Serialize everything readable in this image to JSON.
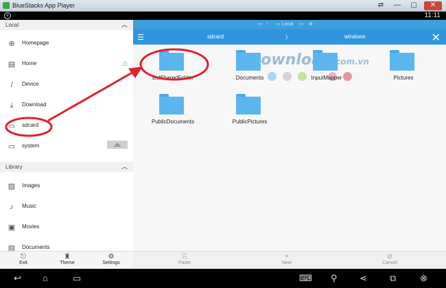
{
  "window": {
    "title": "BlueStacks App Player",
    "controls": [
      "⇄",
      "—",
      "▢",
      "✕"
    ]
  },
  "status_bar": {
    "time": "11:11"
  },
  "sidebar": {
    "local_header": "Local",
    "library_header": "Library",
    "items": [
      {
        "label": "Homepage",
        "icon": "globe-icon"
      },
      {
        "label": "Home",
        "icon": "phone-home-icon"
      },
      {
        "label": "Device",
        "icon": "slash-icon"
      },
      {
        "label": "Download",
        "icon": "download-icon"
      },
      {
        "label": "sdcard",
        "icon": "sdcard-icon"
      },
      {
        "label": "system",
        "icon": "system-icon"
      }
    ],
    "library_items": [
      {
        "label": "Images",
        "icon": "image-icon"
      },
      {
        "label": "Music",
        "icon": "music-icon"
      },
      {
        "label": "Movies",
        "icon": "movie-icon"
      },
      {
        "label": "Documents",
        "icon": "document-icon"
      }
    ]
  },
  "left_toolbar": {
    "exit": "Exit",
    "theme": "Theme",
    "settings": "Settings"
  },
  "path_bar": {
    "location": "Local"
  },
  "breadcrumb": {
    "current": "sdcard",
    "separator": "〉",
    "next": "windows"
  },
  "files": [
    {
      "name": "BstSharedFolder"
    },
    {
      "name": "Documents"
    },
    {
      "name": "InputMapper"
    },
    {
      "name": "Pictures"
    },
    {
      "name": "PublicDocuments"
    },
    {
      "name": "PublicPictures"
    }
  ],
  "watermark": {
    "brand": "Download",
    "tld": ".com.vn"
  },
  "right_toolbar": {
    "paste": "Paste",
    "new": "New",
    "cancel": "Cancel"
  },
  "colors": {
    "accent": "#2f96dd",
    "folder": "#5bb6f0",
    "annotation": "#e0202a"
  }
}
